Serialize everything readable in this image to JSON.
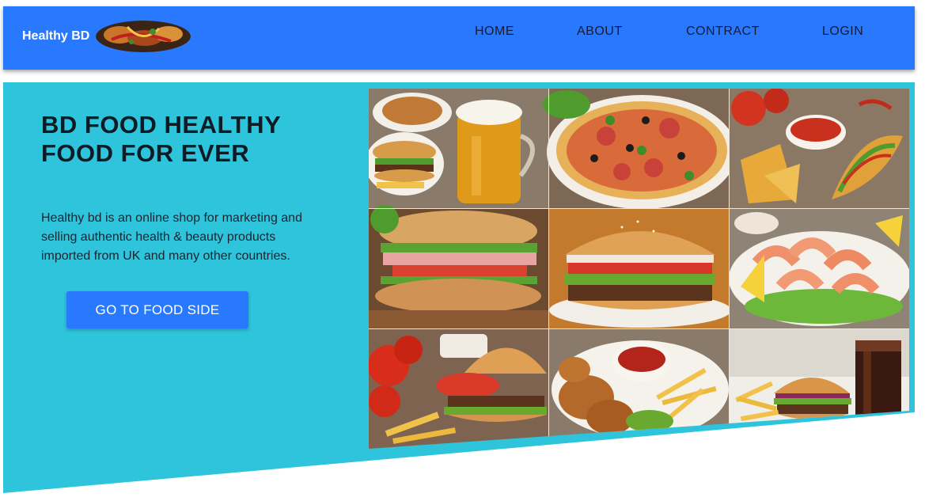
{
  "brand": {
    "name": "Healthy BD",
    "logo_icon": "food-platter-icon"
  },
  "nav": {
    "items": [
      {
        "label": "HOME"
      },
      {
        "label": "ABOUT"
      },
      {
        "label": "CONTRACT"
      },
      {
        "label": "LOGIN"
      }
    ]
  },
  "hero": {
    "title": "BD FOOD HEALTHY FOOD FOR EVER",
    "description": "Healthy bd is an online shop for marketing and selling authentic health & beauty products imported from UK and many other countries.",
    "button_label": "GO TO FOOD SIDE"
  },
  "colors": {
    "navbar": "#2979ff",
    "hero_background": "#2ec4dc",
    "button": "#2979ff"
  },
  "collage": {
    "tiles": [
      {
        "icon": "fried-chicken-burger-beer-image"
      },
      {
        "icon": "pizza-image"
      },
      {
        "icon": "nachos-tacos-image"
      },
      {
        "icon": "ham-sandwich-image"
      },
      {
        "icon": "burger-image"
      },
      {
        "icon": "shrimp-plate-image"
      },
      {
        "icon": "burger-fries-tomato-image"
      },
      {
        "icon": "chicken-wings-ketchup-image"
      },
      {
        "icon": "burger-fries-cola-image"
      }
    ]
  }
}
